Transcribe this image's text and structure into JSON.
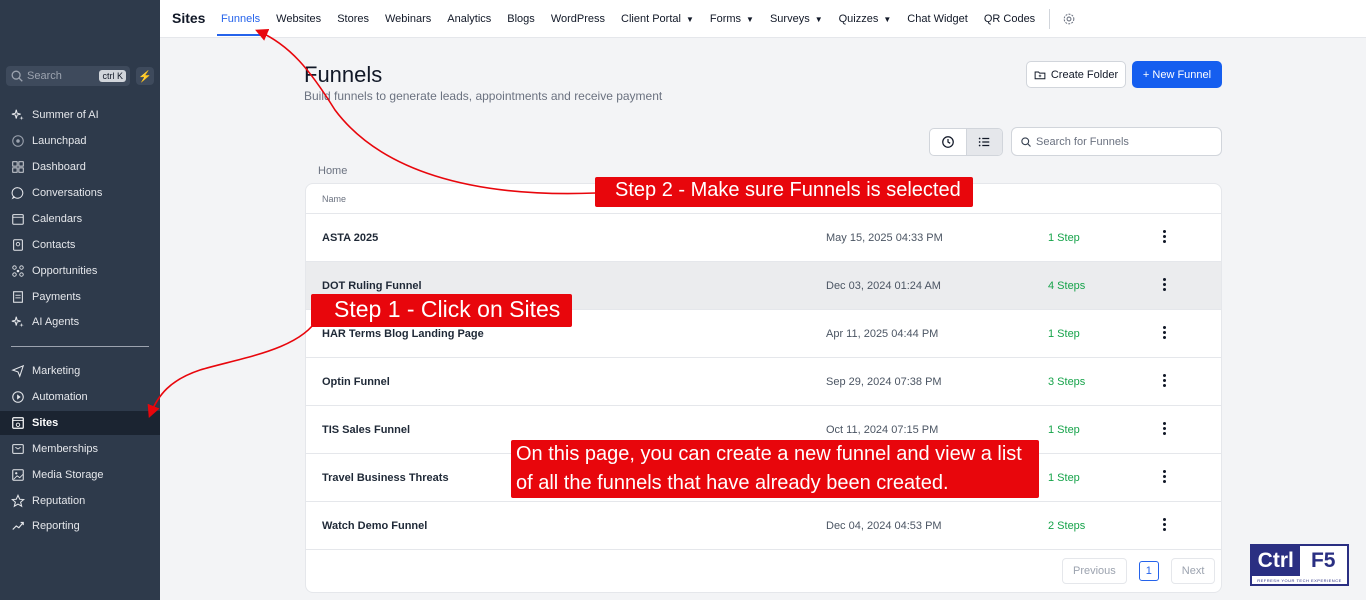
{
  "sidebar": {
    "search": {
      "placeholder": "Search",
      "shortcut": "ctrl K"
    },
    "items": [
      {
        "label": "Summer of AI",
        "icon": "sparkle-icon"
      },
      {
        "label": "Launchpad",
        "icon": "rocket-icon"
      },
      {
        "label": "Dashboard",
        "icon": "dashboard-icon"
      },
      {
        "label": "Conversations",
        "icon": "chat-icon"
      },
      {
        "label": "Calendars",
        "icon": "calendar-icon"
      },
      {
        "label": "Contacts",
        "icon": "contacts-icon"
      },
      {
        "label": "Opportunities",
        "icon": "opportunities-icon"
      },
      {
        "label": "Payments",
        "icon": "payments-icon"
      },
      {
        "label": "AI Agents",
        "icon": "sparkle-icon"
      },
      {
        "label": "Marketing",
        "icon": "send-icon"
      },
      {
        "label": "Automation",
        "icon": "automation-icon"
      },
      {
        "label": "Sites",
        "icon": "sites-icon",
        "active": true
      },
      {
        "label": "Memberships",
        "icon": "memberships-icon"
      },
      {
        "label": "Media Storage",
        "icon": "image-icon"
      },
      {
        "label": "Reputation",
        "icon": "star-icon"
      },
      {
        "label": "Reporting",
        "icon": "trend-icon"
      }
    ]
  },
  "topbar": {
    "brand": "Sites",
    "tabs": [
      {
        "label": "Funnels",
        "active": true
      },
      {
        "label": "Websites"
      },
      {
        "label": "Stores"
      },
      {
        "label": "Webinars"
      },
      {
        "label": "Analytics"
      },
      {
        "label": "Blogs"
      },
      {
        "label": "WordPress"
      },
      {
        "label": "Client Portal",
        "dropdown": true
      },
      {
        "label": "Forms",
        "dropdown": true
      },
      {
        "label": "Surveys",
        "dropdown": true
      },
      {
        "label": "Quizzes",
        "dropdown": true
      },
      {
        "label": "Chat Widget"
      },
      {
        "label": "QR Codes"
      }
    ]
  },
  "main": {
    "title": "Funnels",
    "subtitle": "Build funnels to generate leads, appointments and receive payment",
    "create_folder": "Create Folder",
    "new_funnel": "+ New Funnel",
    "search_placeholder": "Search for Funnels",
    "breadcrumb": "Home",
    "column_name": "Name",
    "rows": [
      {
        "name": "ASTA 2025",
        "date": "May 15, 2025 04:33 PM",
        "steps": "1 Step"
      },
      {
        "name": "DOT Ruling Funnel",
        "date": "Dec 03, 2024 01:24 AM",
        "steps": "4 Steps"
      },
      {
        "name": "HAR Terms Blog Landing Page",
        "date": "Apr 11, 2025 04:44 PM",
        "steps": "1 Step"
      },
      {
        "name": "Optin Funnel",
        "date": "Sep 29, 2024 07:38 PM",
        "steps": "3 Steps"
      },
      {
        "name": "TIS Sales Funnel",
        "date": "Oct 11, 2024 07:15 PM",
        "steps": "1 Step"
      },
      {
        "name": "Travel Business Threats",
        "date": "",
        "steps": "1 Step"
      },
      {
        "name": "Watch Demo Funnel",
        "date": "Dec 04, 2024 04:53 PM",
        "steps": "2 Steps"
      }
    ],
    "pagination": {
      "previous": "Previous",
      "page": "1",
      "next": "Next"
    }
  },
  "annotations": {
    "step2": "Step 2 - Make sure Funnels is selected",
    "step1": "Step 1 - Click on Sites",
    "note_line1": "On this page, you can create a new funnel and view a list",
    "note_line2": "of all the funnels that have already been created."
  },
  "logo": {
    "part1": "Ctrl",
    "part2": "F5",
    "tagline": "REFRESH YOUR TECH EXPERIENCE"
  },
  "colors": {
    "sidebar": "#2e3a4b",
    "accent": "#155eef",
    "callout": "#e8060c",
    "steps": "#16a34a"
  }
}
